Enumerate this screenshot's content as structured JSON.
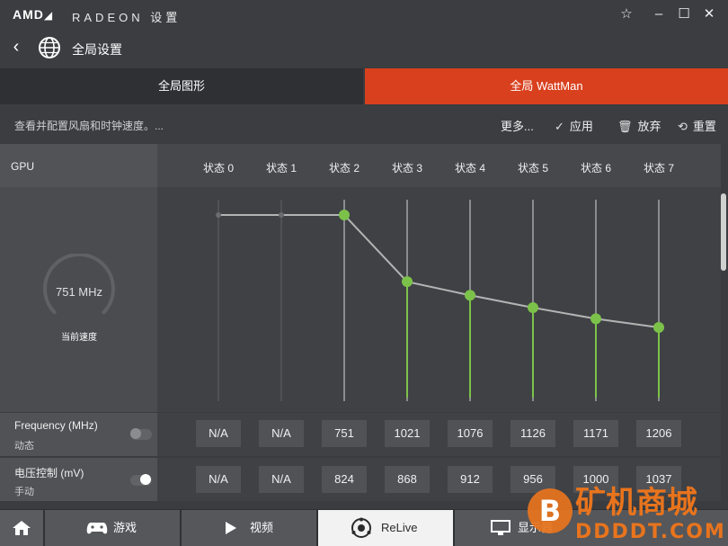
{
  "titlebar": {
    "brand": "AMD",
    "brand_symbol": "◢",
    "app_name": "RADEON 设置"
  },
  "nav": {
    "title": "全局设置"
  },
  "tabs": [
    {
      "label": "全局图形"
    },
    {
      "label": "全局 WattMan"
    }
  ],
  "toolbar": {
    "description": "查看并配置风扇和时钟速度。...",
    "more": "更多...",
    "apply": "应用",
    "discard": "放弃",
    "reset": "重置"
  },
  "gpu": {
    "label": "GPU",
    "current_speed": "751 MHz",
    "current_speed_caption": "当前速度"
  },
  "states": [
    "状态 0",
    "状态 1",
    "状态 2",
    "状态 3",
    "状态 4",
    "状态 5",
    "状态 6",
    "状态 7"
  ],
  "frequency": {
    "label": "Frequency (MHz)",
    "mode": "动态",
    "values": [
      "N/A",
      "N/A",
      "751",
      "1021",
      "1076",
      "1126",
      "1171",
      "1206"
    ]
  },
  "voltage": {
    "label": "电压控制 (mV)",
    "mode": "手动",
    "values": [
      "N/A",
      "N/A",
      "824",
      "868",
      "912",
      "956",
      "1000",
      "1037"
    ]
  },
  "chart_data": {
    "type": "line",
    "x": [
      "状态 0",
      "状态 1",
      "状态 2",
      "状态 3",
      "状态 4",
      "状态 5",
      "状态 6",
      "状态 7"
    ],
    "values": [
      null,
      null,
      751,
      1021,
      1076,
      1126,
      1171,
      1206
    ],
    "baseline": 751,
    "active_states": [
      2,
      3,
      4,
      5,
      6,
      7
    ],
    "grid": false
  },
  "bottom_nav": [
    {
      "label": "",
      "icon": "home-icon"
    },
    {
      "label": "游戏",
      "icon": "gamepad-icon"
    },
    {
      "label": "视频",
      "icon": "play-icon"
    },
    {
      "label": "ReLive",
      "icon": "relive-icon"
    },
    {
      "label": "显示器",
      "icon": "monitor-icon"
    }
  ],
  "watermark": {
    "text": "矿机商城",
    "subtext": "DDDDT.COM",
    "logo_letter": "B"
  },
  "colors": {
    "accent": "#d9401e",
    "green": "#7cc24a",
    "line": "#b4b4b4"
  }
}
